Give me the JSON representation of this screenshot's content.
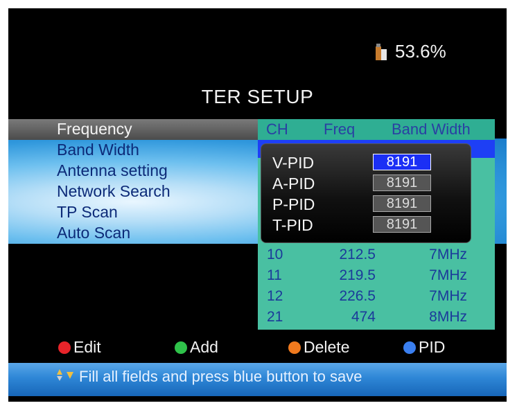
{
  "usage": {
    "value": "53.6%",
    "icon": "usb-disk-icon"
  },
  "title": "TER SETUP",
  "menu": {
    "items": [
      {
        "label": "Frequency"
      },
      {
        "label": "Band Width"
      },
      {
        "label": "Antenna setting"
      },
      {
        "label": "Network Search"
      },
      {
        "label": "TP Scan"
      },
      {
        "label": "Auto Scan"
      }
    ]
  },
  "table": {
    "headers": [
      "CH",
      "Freq",
      "Band Width"
    ],
    "rows": [
      {
        "ch": "10",
        "freq": "212.5",
        "bw": "7MHz"
      },
      {
        "ch": "11",
        "freq": "219.5",
        "bw": "7MHz"
      },
      {
        "ch": "12",
        "freq": "226.5",
        "bw": "7MHz"
      },
      {
        "ch": "21",
        "freq": "474",
        "bw": "8MHz"
      }
    ]
  },
  "pid": {
    "rows": [
      {
        "label": "V-PID",
        "value": "8191"
      },
      {
        "label": "A-PID",
        "value": "8191"
      },
      {
        "label": "P-PID",
        "value": "8191"
      },
      {
        "label": "T-PID",
        "value": "8191"
      }
    ]
  },
  "legend": {
    "edit": "Edit",
    "add": "Add",
    "delete": "Delete",
    "pid": "PID"
  },
  "hint": "Fill all fields and press blue button to save",
  "colors": {
    "red": "#e8242a",
    "green": "#2fc24a",
    "orange": "#f07a1e",
    "blue": "#3a7ff0"
  }
}
